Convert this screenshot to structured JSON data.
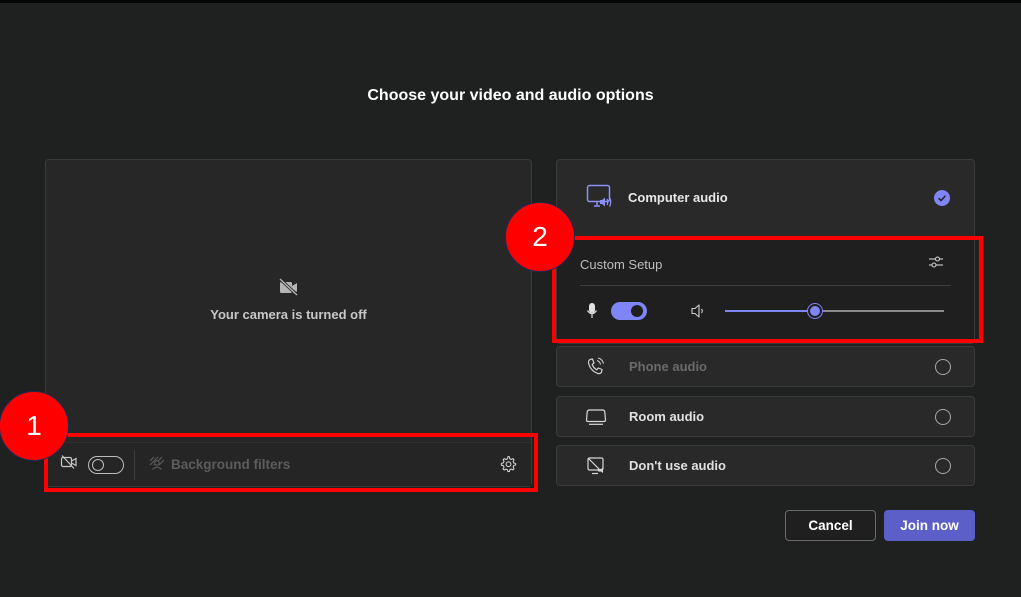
{
  "dialog": {
    "title": "Choose your video and audio options"
  },
  "video_preview": {
    "camera_off_icon": "video-off-icon",
    "camera_off_message": "Your camera is turned off",
    "toolbar": {
      "camera_icon": "video-off-icon",
      "camera_toggle": {
        "state": "off"
      },
      "background_filters_icon": "background-blur-icon",
      "background_filters_label": "Background filters",
      "background_filters_disabled": true,
      "settings_icon": "gear-icon"
    }
  },
  "audio_options": {
    "computer_audio": {
      "icon": "monitor-speaker-icon",
      "label": "Computer audio",
      "selected": true,
      "custom_setup": {
        "label": "Custom Setup",
        "settings_icon": "sliders-icon",
        "mic_icon": "microphone-icon",
        "mic_toggle": {
          "state": "on"
        },
        "speaker_icon": "speaker-icon",
        "volume_fraction": 0.41
      }
    },
    "options": [
      {
        "icon": "phone-audio-icon",
        "label": "Phone audio",
        "selected": false,
        "disabled": true
      },
      {
        "icon": "room-audio-icon",
        "label": "Room audio",
        "selected": false,
        "disabled": false
      },
      {
        "icon": "no-audio-icon",
        "label": "Don't use audio",
        "selected": false,
        "disabled": false
      }
    ]
  },
  "actions": {
    "cancel_label": "Cancel",
    "join_label": "Join now"
  },
  "annotations": [
    {
      "number": "1",
      "target": "video-toolbar"
    },
    {
      "number": "2",
      "target": "custom-audio-setup"
    }
  ],
  "colors": {
    "accent": "#7f85f5",
    "primary_button": "#5b5fc7",
    "annotation_red": "#ff0000",
    "background": "#1f2020"
  }
}
